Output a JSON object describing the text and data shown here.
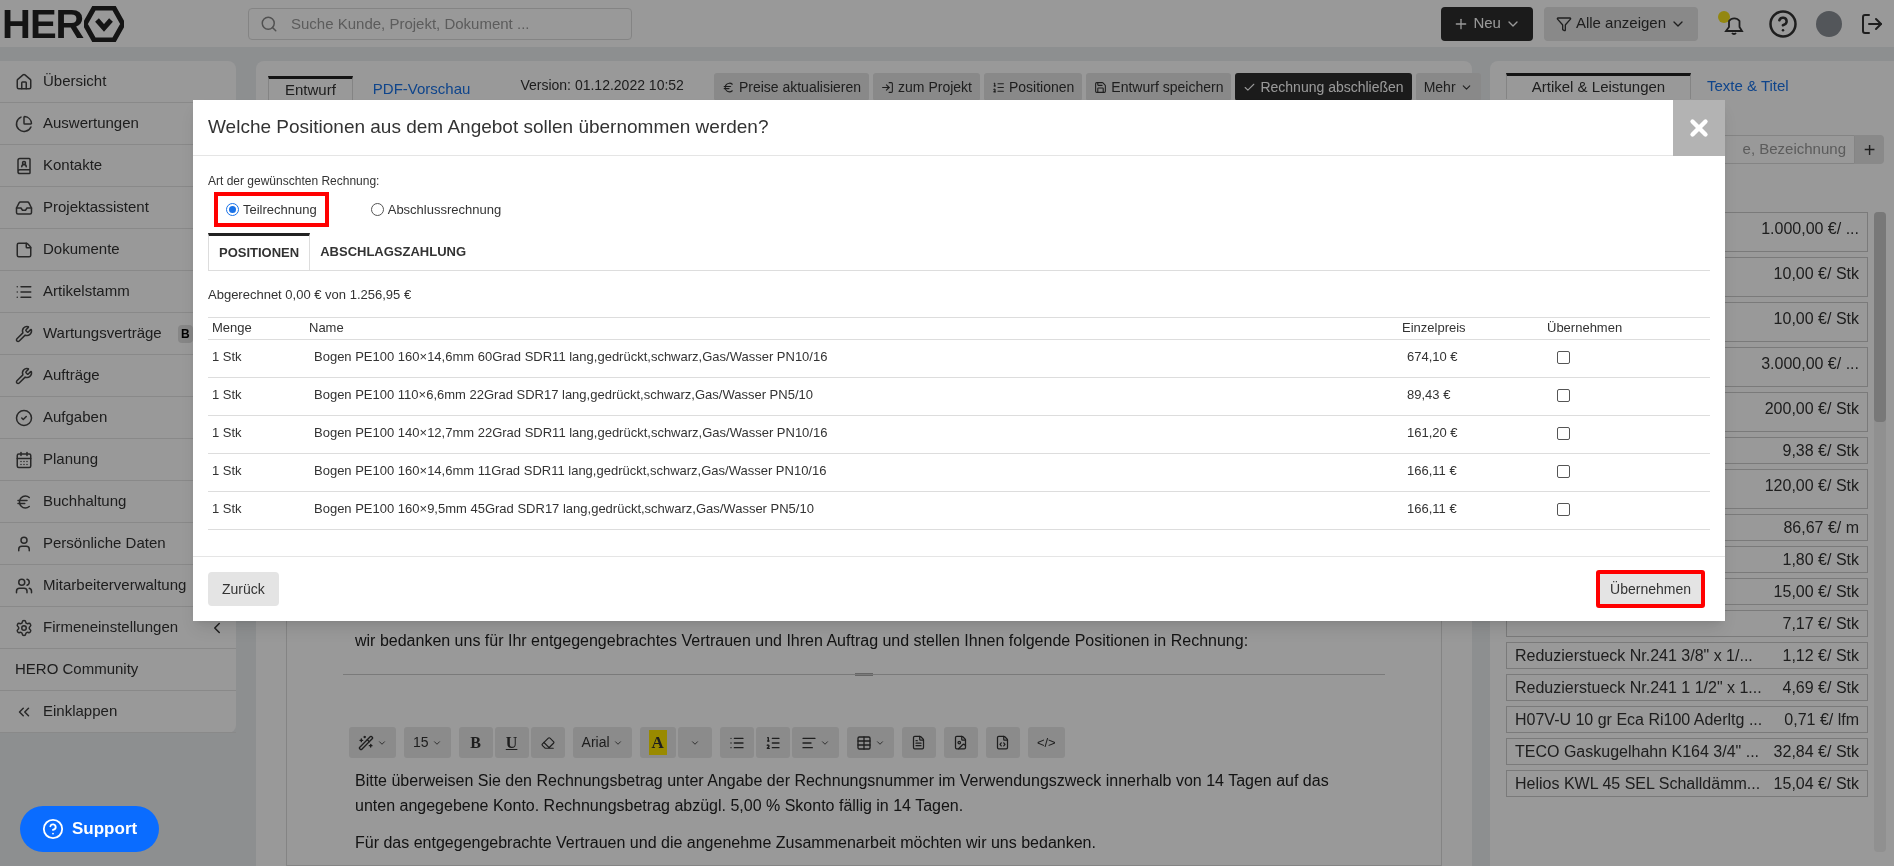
{
  "header": {
    "logo_text": "HER",
    "search_placeholder": "Suche Kunde, Projekt, Dokument ...",
    "new_button": "Neu",
    "filter_button": "Alle anzeigen"
  },
  "sidebar": {
    "items": [
      {
        "label": "Übersicht"
      },
      {
        "label": "Auswertungen"
      },
      {
        "label": "Kontakte"
      },
      {
        "label": "Projektassistent"
      },
      {
        "label": "Dokumente"
      },
      {
        "label": "Artikelstamm"
      },
      {
        "label": "Wartungsverträge",
        "badge": "B"
      },
      {
        "label": "Aufträge"
      },
      {
        "label": "Aufgaben"
      },
      {
        "label": "Planung"
      },
      {
        "label": "Buchhaltung"
      },
      {
        "label": "Persönliche Daten"
      },
      {
        "label": "Mitarbeiterverwaltung"
      },
      {
        "label": "Firmeneinstellungen"
      },
      {
        "label": "HERO Community"
      },
      {
        "label": "Einklappen"
      }
    ]
  },
  "editor": {
    "tabs": [
      {
        "label": "Entwurf",
        "selected": true
      },
      {
        "label": "PDF-Vorschau",
        "selected": false
      }
    ],
    "version": "Version: 01.12.2022 10:52",
    "actions": [
      {
        "label": "Preise aktualisieren",
        "primary": false
      },
      {
        "label": "zum Projekt",
        "primary": false
      },
      {
        "label": "Positionen",
        "primary": false
      },
      {
        "label": "Entwurf speichern",
        "primary": false
      },
      {
        "label": "Rechnung abschließen",
        "primary": true
      },
      {
        "label": "Mehr",
        "primary": false
      }
    ],
    "intro": "wir bedanken uns für Ihr entgegengebrachtes Vertrauen und Ihren Auftrag und stellen Ihnen folgende Positionen in Rechnung:",
    "toolbar": {
      "font_size": "15",
      "bold": "B",
      "underline": "U",
      "font": "Arial",
      "highlight": "A",
      "code": "</>"
    },
    "paragraphs": [
      "Bitte überweisen Sie den Rechnungsbetrag unter Angabe der Rechnungsnummer im Verwendungszweck innerhalb von 14 Tagen auf das unten angegebene Konto. Rechnungsbetrag abzügl. 5,00 % Skonto fällig in 14 Tagen.",
      "Für das entgegengebrachte Vertrauen und die angenehme Zusammenarbeit möchten wir uns bedanken."
    ]
  },
  "right_panel": {
    "tabs": [
      {
        "label": "Artikel & Leistungen",
        "selected": true
      },
      {
        "label": "Texte & Titel",
        "selected": false
      }
    ],
    "search_placeholder": "e, Bezeichnung",
    "add_button": "+",
    "items": [
      {
        "kind": "tall",
        "price": "1.000,00 €/ ..."
      },
      {
        "kind": "tall",
        "price": "10,00 €/ Stk"
      },
      {
        "kind": "tall",
        "price": "10,00 €/ Stk"
      },
      {
        "kind": "tall",
        "price": "3.000,00 €/ ..."
      },
      {
        "kind": "tall",
        "price": "200,00 €/ Stk"
      },
      {
        "kind": "single",
        "price": "9,38 €/ Stk"
      },
      {
        "kind": "tall",
        "price": "120,00 €/ Stk"
      },
      {
        "kind": "single",
        "price": "86,67 €/ m"
      },
      {
        "kind": "single",
        "price": "1,80 €/ Stk"
      },
      {
        "kind": "single",
        "price": "15,00 €/ Stk"
      },
      {
        "kind": "single",
        "price": "7,17 €/ Stk"
      },
      {
        "kind": "single",
        "name": "Reduzierstueck Nr.241 3/8\" x 1/...",
        "price": "1,12 €/ Stk"
      },
      {
        "kind": "single",
        "name": "Reduzierstueck Nr.241 1 1/2\" x 1...",
        "price": "4,69 €/ Stk"
      },
      {
        "kind": "single",
        "name": "H07V-U 10 gr Eca Ri100 Aderltg ...",
        "price": "0,71 €/ lfm"
      },
      {
        "kind": "single",
        "name": "TECO Gaskugelhahn K164 3/4\" ...",
        "price": "32,84 €/ Stk"
      },
      {
        "kind": "single",
        "name": "Helios KWL 45 SEL Schalldämm...",
        "price": "15,04 €/ Stk"
      }
    ]
  },
  "support_button": "Support",
  "modal": {
    "title": "Welche Positionen aus dem Angebot sollen übernommen werden?",
    "invoice_type_label": "Art der gewünschten Rechnung:",
    "invoice_types": [
      {
        "label": "Teilrechnung",
        "selected": true,
        "highlighted": true
      },
      {
        "label": "Abschlussrechnung",
        "selected": false,
        "highlighted": false
      }
    ],
    "tabs": [
      {
        "label": "POSITIONEN",
        "selected": true
      },
      {
        "label": "ABSCHLAGSZAHLUNG",
        "selected": false
      }
    ],
    "summary": "Abgerechnet 0,00 € von 1.256,95 €",
    "table": {
      "columns": [
        "Menge",
        "Name",
        "Einzelpreis",
        "Übernehmen"
      ],
      "rows": [
        {
          "menge": "1 Stk",
          "name": "Bogen PE100 160×14,6mm 60Grad SDR11 lang,gedrückt,schwarz,Gas/Wasser PN10/16",
          "einzelpreis": "674,10 €",
          "checked": false
        },
        {
          "menge": "1 Stk",
          "name": "Bogen PE100 110×6,6mm 22Grad SDR17 lang,gedrückt,schwarz,Gas/Wasser PN5/10",
          "einzelpreis": "89,43 €",
          "checked": false
        },
        {
          "menge": "1 Stk",
          "name": "Bogen PE100 140×12,7mm 22Grad SDR11 lang,gedrückt,schwarz,Gas/Wasser PN10/16",
          "einzelpreis": "161,20 €",
          "checked": false
        },
        {
          "menge": "1 Stk",
          "name": "Bogen PE100 160×14,6mm 11Grad SDR11 lang,gedrückt,schwarz,Gas/Wasser PN10/16",
          "einzelpreis": "166,11 €",
          "checked": false
        },
        {
          "menge": "1 Stk",
          "name": "Bogen PE100 160×9,5mm 45Grad SDR17 lang,gedrückt,schwarz,Gas/Wasser PN5/10",
          "einzelpreis": "166,11 €",
          "checked": false
        }
      ]
    },
    "back_button": "Zurück",
    "confirm_button": {
      "label": "Übernehmen",
      "highlighted": true
    }
  }
}
